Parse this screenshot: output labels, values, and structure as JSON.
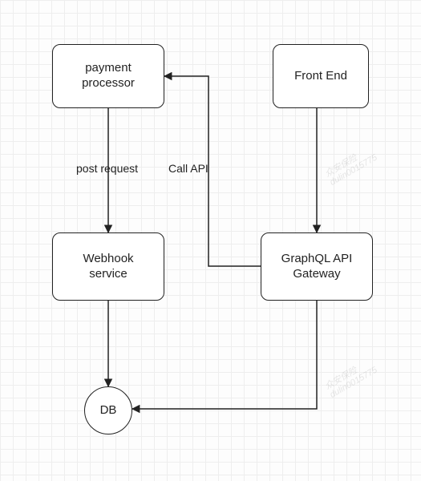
{
  "nodes": {
    "payment_processor": "payment\nprocessor",
    "front_end": "Front End",
    "webhook_service": "Webhook\nservice",
    "graphql_gateway": "GraphQL API\nGateway",
    "db": "DB"
  },
  "edges": {
    "post_request": "post request",
    "call_api": "Call API"
  },
  "watermark": {
    "line1": "众安保险",
    "line2": "dulin0015775"
  },
  "chart_data": {
    "type": "diagram",
    "title": "",
    "nodes": [
      {
        "id": "payment_processor",
        "label": "payment processor",
        "shape": "rounded-rect"
      },
      {
        "id": "front_end",
        "label": "Front End",
        "shape": "rounded-rect"
      },
      {
        "id": "webhook_service",
        "label": "Webhook service",
        "shape": "rounded-rect"
      },
      {
        "id": "graphql_gateway",
        "label": "GraphQL API Gateway",
        "shape": "rounded-rect"
      },
      {
        "id": "db",
        "label": "DB",
        "shape": "circle"
      }
    ],
    "edges": [
      {
        "from": "payment_processor",
        "to": "webhook_service",
        "label": "post request",
        "directed": true
      },
      {
        "from": "graphql_gateway",
        "to": "payment_processor",
        "label": "Call API",
        "directed": true
      },
      {
        "from": "front_end",
        "to": "graphql_gateway",
        "label": "",
        "directed": true
      },
      {
        "from": "webhook_service",
        "to": "db",
        "label": "",
        "directed": true
      },
      {
        "from": "graphql_gateway",
        "to": "db",
        "label": "",
        "directed": true
      }
    ]
  }
}
